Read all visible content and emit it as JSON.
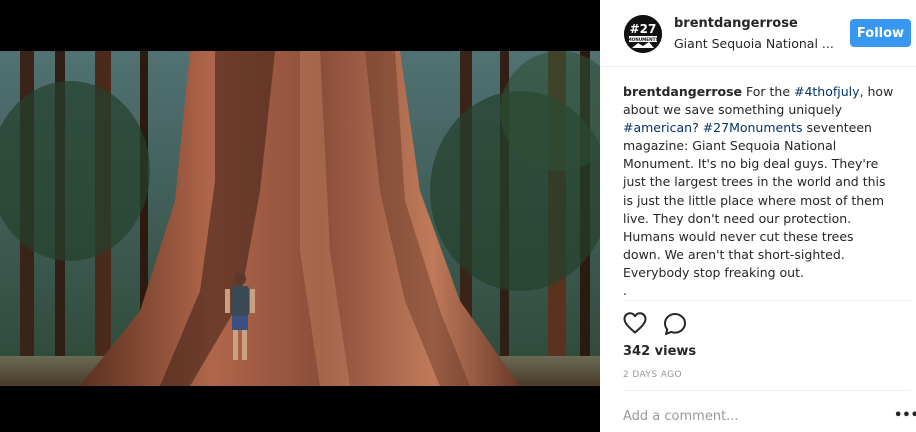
{
  "post": {
    "username": "brentdangerrose",
    "location": "Giant Sequoia National ...",
    "follow_label": "Follow",
    "avatar_text": "#27",
    "avatar_subtext": "MONUMENTS",
    "caption": {
      "username": "brentdangerrose",
      "text_1": " For the ",
      "tag_1": "#4thofjuly",
      "text_2": ", how about we save something uniquely ",
      "tag_2": "#american",
      "text_3": "? ",
      "tag_3": "#27Monuments",
      "text_4": " seventeen magazine: Giant Sequoia National Monument. It's no big deal guys. They're just the largest trees in the world and this is just the little place where most of them live. They don't need our protection. Humans would never cut these trees down. We aren't that short-sighted. Everybody stop freaking out.",
      "trailing": "."
    },
    "views": "342 views",
    "time_ago": "2 DAYS AGO",
    "comment_placeholder": "Add a comment...",
    "more_label": "•••"
  },
  "icons": [
    "heart-icon",
    "comment-icon"
  ],
  "colors": {
    "follow_bg": "#3897f0",
    "hashtag": "#003569",
    "muted": "#999999",
    "text": "#262626"
  }
}
